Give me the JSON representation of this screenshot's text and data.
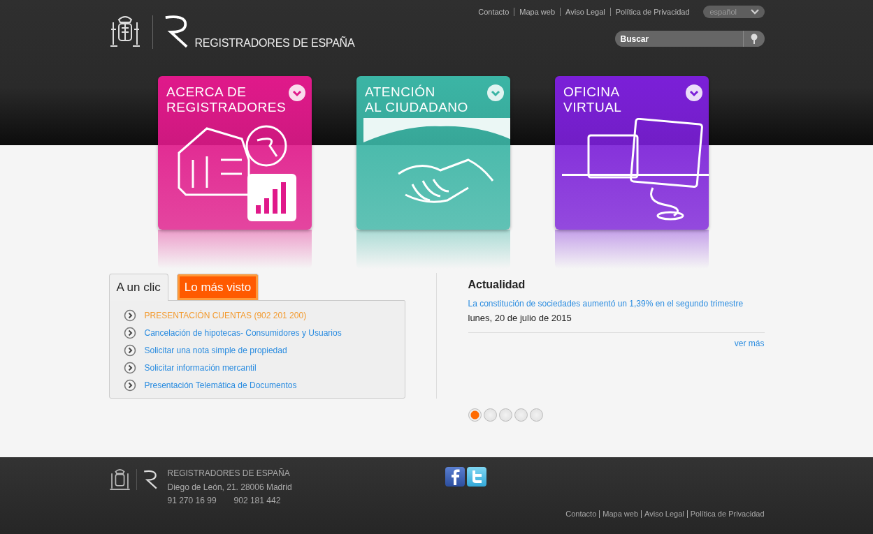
{
  "header": {
    "brand": "REGISTRADORES DE ESPAÑA",
    "top_links": [
      "Contacto",
      "Mapa web",
      "Aviso Legal",
      "Política de Privacidad"
    ],
    "language": {
      "value": "español"
    },
    "search": {
      "placeholder": "Buscar"
    }
  },
  "tiles": [
    {
      "kind": "house",
      "title_lines": [
        "ACERCA DE",
        "REGISTRADORES"
      ],
      "color": "#e0198a"
    },
    {
      "kind": "handshake",
      "title_lines": [
        "ATENCIÓN",
        "AL CIUDADANO"
      ],
      "color": "#3bb5a5"
    },
    {
      "kind": "computer",
      "title_lines": [
        "OFICINA",
        "VIRTUAL"
      ],
      "color": "#7b1fd8"
    }
  ],
  "tabs": [
    {
      "label": "A un clic",
      "selected": true
    },
    {
      "label": "Lo más visto",
      "selected": false
    }
  ],
  "links": [
    {
      "label": "PRESENTACIÓN CUENTAS (902 201 200)",
      "highlighted": true
    },
    {
      "label": "Cancelación de hipotecas- Consumidores y Usuarios",
      "highlighted": false
    },
    {
      "label": "Solicitar una nota simple de propiedad",
      "highlighted": false
    },
    {
      "label": "Solicitar información mercantil",
      "highlighted": false
    },
    {
      "label": "Presentación Telemática de Documentos",
      "highlighted": false
    }
  ],
  "news": {
    "heading": "Actualidad",
    "headline": "La constitución de sociedades aumentó un 1,39% en el segundo trimestre",
    "date": "lunes, 20 de julio de 2015",
    "more": "ver más"
  },
  "carousel_dots": [
    {
      "selected": true
    },
    {
      "selected": false
    },
    {
      "selected": false
    },
    {
      "selected": false
    },
    {
      "selected": false
    }
  ],
  "footer": {
    "name": "REGISTRADORES DE ESPAÑA",
    "address": "Diego de León, 21. 28006 Madrid",
    "phones": [
      "91 270 16 99",
      "902 181 442"
    ],
    "links": [
      "Contacto",
      "Mapa web",
      "Aviso Legal",
      "Política de Privacidad"
    ]
  }
}
